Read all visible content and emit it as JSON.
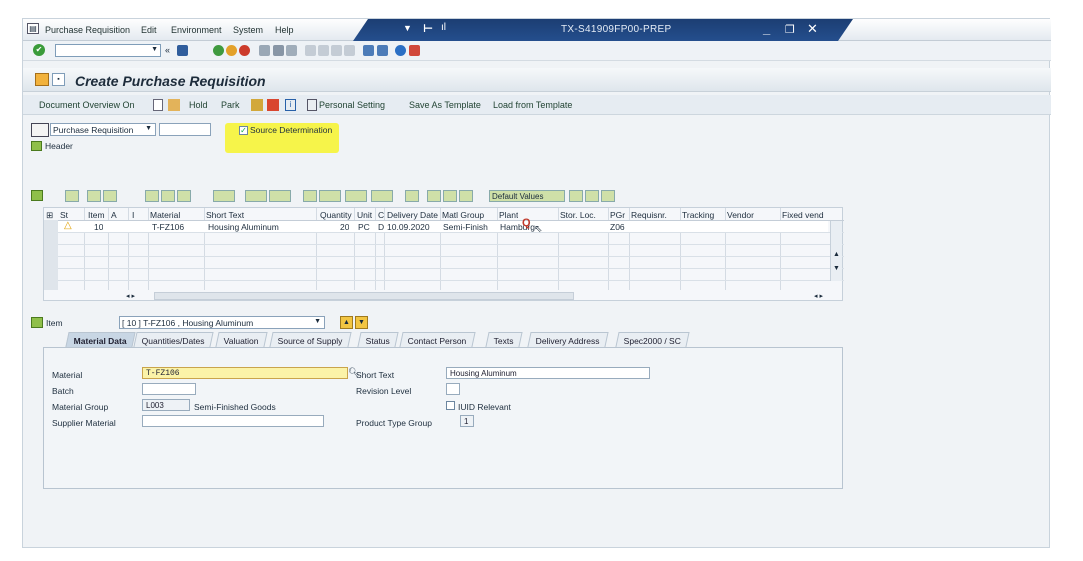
{
  "menu": [
    "Purchase Requisition",
    "Edit",
    "Environment",
    "System",
    "Help"
  ],
  "window": {
    "system_title": "TX-S41909FP00-PREP"
  },
  "page_title": "Create Purchase Requisition",
  "app_toolbar": {
    "doc_overview": "Document Overview On",
    "hold": "Hold",
    "park": "Park",
    "personal_setting": "Personal Setting",
    "save_as_template": "Save As Template",
    "load_from_template": "Load from Template"
  },
  "header_section": {
    "doc_type": "Purchase Requisition",
    "source_determination": "Source Determination",
    "header_label": "Header"
  },
  "grid": {
    "default_values": "Default Values",
    "columns": [
      "St",
      "Item",
      "A",
      "I",
      "Material",
      "Short Text",
      "Quantity",
      "Unit",
      "C",
      "Delivery Date",
      "Matl Group",
      "Plant",
      "Stor. Loc.",
      "PGr",
      "Requisnr.",
      "Tracking",
      "Vendor",
      "Fixed vend"
    ],
    "row": [
      "10",
      "T-FZ106",
      "Housing Aluminum",
      "20",
      "PC",
      "D",
      "10.09.2020",
      "Semi-Finish",
      "Hamburg",
      "Z06"
    ]
  },
  "item_section": {
    "label": "Item",
    "selected": "[ 10 ] T-FZ106 , Housing Aluminum",
    "tabs": [
      "Material Data",
      "Quantities/Dates",
      "Valuation",
      "Source of Supply",
      "Status",
      "Contact Person",
      "Texts",
      "Delivery Address",
      "Spec2000 / SC"
    ]
  },
  "material_data": {
    "material_label": "Material",
    "material_value": "T-FZ106",
    "short_text_label": "Short Text",
    "short_text_value": "Housing Aluminum",
    "batch_label": "Batch",
    "revision_level_label": "Revision Level",
    "material_group_label": "Material Group",
    "material_group_code": "L003",
    "material_group_desc": "Semi-Finished Goods",
    "iuid_label": "IUID Relevant",
    "supplier_material_label": "Supplier Material",
    "product_type_group_label": "Product Type Group",
    "product_type_group_value": "1"
  }
}
